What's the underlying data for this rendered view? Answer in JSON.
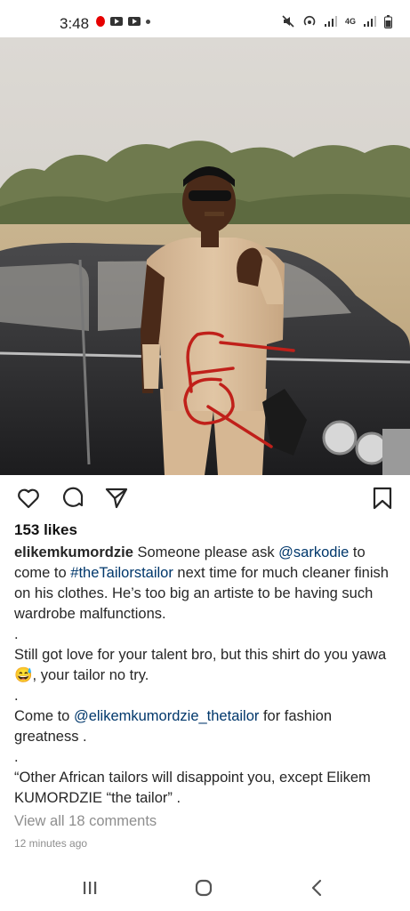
{
  "status_bar": {
    "time": "3:48",
    "network": "4G"
  },
  "post": {
    "likes": "153 likes",
    "caption": {
      "username": "elikemkumordzie",
      "line1_a": "Someone please ask ",
      "mention1": "@sarkodie",
      "line1_b": " to come to ",
      "hashtag": "#theTailorstailor",
      "line1_c": " next time for much cleaner finish on his clothes. He’s too big an artiste to be having such wardrobe malfunctions.",
      "dot1": ".",
      "line2": "Still got love for your talent bro, but this shirt do you yawa",
      "emoji": "😅",
      "line2_b": ", your tailor no try.",
      "dot2": ".",
      "line3_a": "Come to ",
      "mention2": "@elikemkumordzie_thetailor",
      "line3_b": " for fashion greatness .",
      "dot3": ".",
      "line4": "“Other African tailors will disappoint you, except Elikem KUMORDZIE “the tailor” ."
    },
    "view_comments": "View all 18 comments",
    "timestamp": "12 minutes ago"
  },
  "icons": {
    "like": "heart-icon",
    "comment": "comment-icon",
    "share": "send-icon",
    "save": "bookmark-icon"
  },
  "colors": {
    "mention": "#00376b",
    "annotation_marker": "#c0201a"
  }
}
